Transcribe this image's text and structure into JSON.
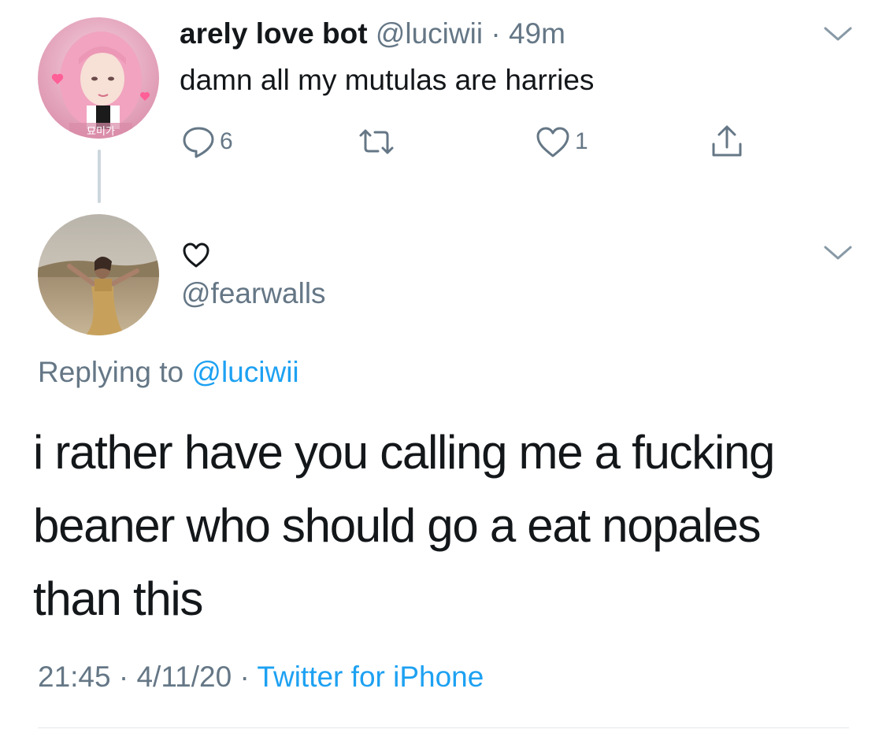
{
  "parent_tweet": {
    "display_name": "arely love bot",
    "handle": "@luciwii",
    "separator": "·",
    "time_ago": "49m",
    "text": "damn all my mutulas are harries",
    "avatar_icon": "avatar-photo-pink-hair",
    "avatar_overlay_text": "묘미가",
    "actions": {
      "reply_count": "6",
      "retweet_count": "",
      "like_count": "1"
    }
  },
  "reply_tweet": {
    "display_name_icon": "heart-outline-icon",
    "handle": "@fearwalls",
    "avatar_icon": "avatar-photo-desert",
    "replying_prefix": "Replying to",
    "replying_mention": "@luciwii",
    "text_lines": [
      "i rather have you calling me a fucking",
      "beaner who should go a eat nopales",
      "than this"
    ],
    "timestamp_time": "21:45",
    "separator": "·",
    "timestamp_date": "4/11/20",
    "source": "Twitter for iPhone"
  },
  "colors": {
    "text_primary": "#14171a",
    "text_secondary": "#657786",
    "link_blue": "#1da1f2",
    "thread_line": "#ccd6dd",
    "divider": "#e1e8ed"
  }
}
